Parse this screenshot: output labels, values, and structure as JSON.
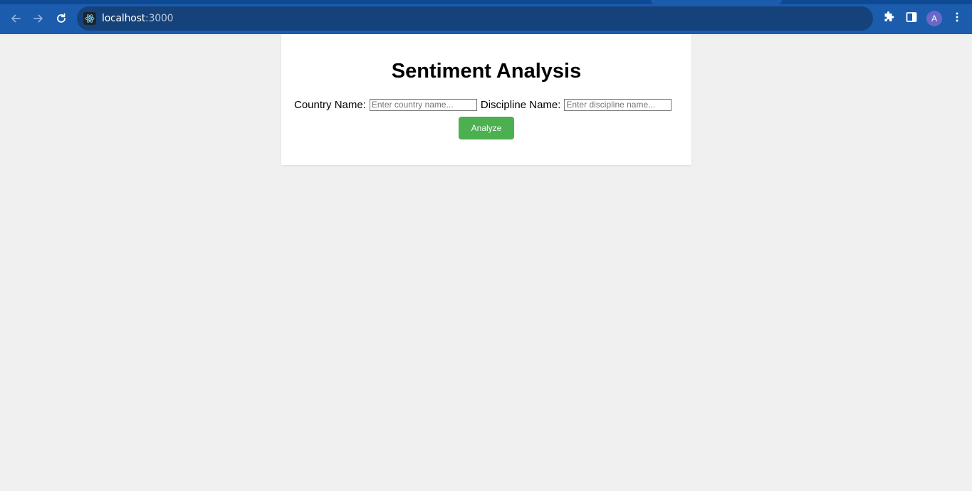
{
  "browser": {
    "url_host": "localhost",
    "url_port": ":3000",
    "profile_initial": "A",
    "colors": {
      "chrome": "#1b5cad",
      "omnibox": "#15427a"
    }
  },
  "page": {
    "title": "Sentiment Analysis",
    "country_label": "Country Name:",
    "country_placeholder": "Enter country name...",
    "discipline_label": "Discipline Name:",
    "discipline_placeholder": "Enter discipline name...",
    "analyze_label": "Analyze",
    "colors": {
      "button": "#4caf50",
      "background": "#f0f0f0"
    }
  },
  "icons": [
    "back-icon",
    "forward-icon",
    "reload-icon",
    "react-site-icon",
    "extensions-icon",
    "side-panel-icon",
    "menu-icon"
  ]
}
